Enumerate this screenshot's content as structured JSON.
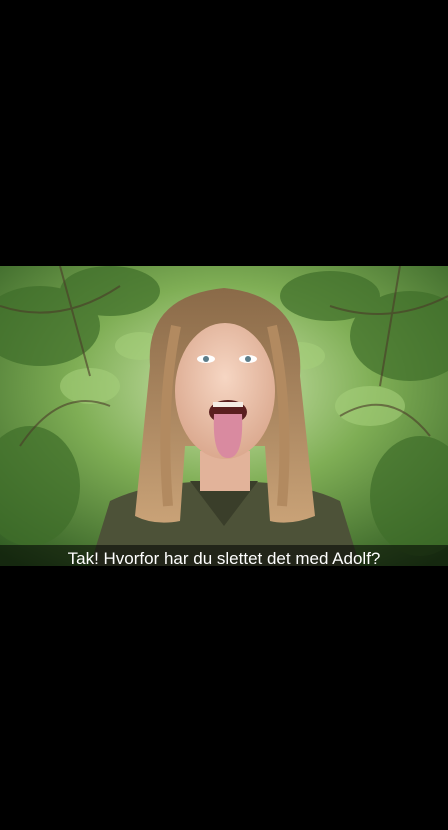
{
  "snap": {
    "caption": "Tak! Hvorfor har du slettet det med Adolf?"
  },
  "colors": {
    "background": "#000000",
    "caption_text": "#ffffff",
    "caption_bar": "#000000"
  }
}
